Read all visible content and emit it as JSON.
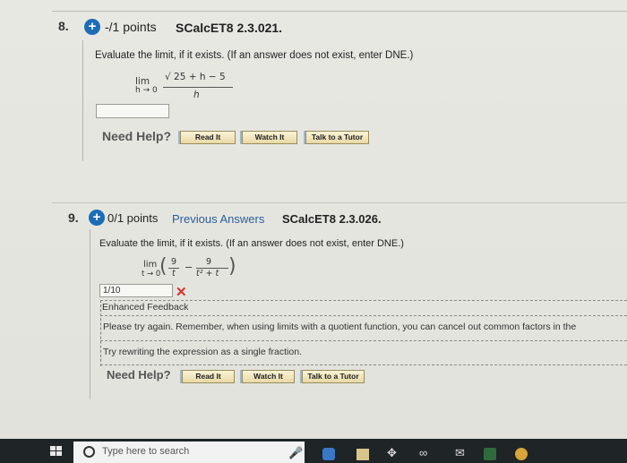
{
  "question8": {
    "number": "8.",
    "points": "-/1 points",
    "code": "SCalcET8 2.3.021.",
    "instruction": "Evaluate the limit, if it exists. (If an answer does not exist, enter DNE.)",
    "lim": "lim",
    "limit_var": "h → 0",
    "numerator": "√ 25 + h  − 5",
    "denominator": "h",
    "answer": "",
    "need_help": "Need Help?",
    "buttons": [
      "Read It",
      "Watch It",
      "Talk to a Tutor"
    ]
  },
  "question9": {
    "number": "9.",
    "points": "0/1 points",
    "previous_answers": "Previous Answers",
    "code": "SCalcET8 2.3.026.",
    "instruction": "Evaluate the limit, if it exists. (If an answer does not exist, enter DNE.)",
    "lim": "lim",
    "limit_var": "t → 0",
    "term1_num": "9",
    "term1_den": "t",
    "minus": "−",
    "term2_num": "9",
    "term2_den": "t² + t",
    "answer": "1/10",
    "status_mark": "✕",
    "feedback_title": "Enhanced Feedback",
    "feedback_text": "Please try again. Remember, when using limits with a quotient function, you can cancel out common factors in the",
    "hint": "Try rewriting the expression as a single fraction.",
    "need_help": "Need Help?",
    "buttons": [
      "Read It",
      "Watch It",
      "Talk to a Tutor"
    ]
  },
  "taskbar": {
    "search_placeholder": "Type here to search"
  },
  "colors": {
    "accent": "#1c6db6",
    "error": "#d6322e",
    "link": "#2c5d9a"
  }
}
